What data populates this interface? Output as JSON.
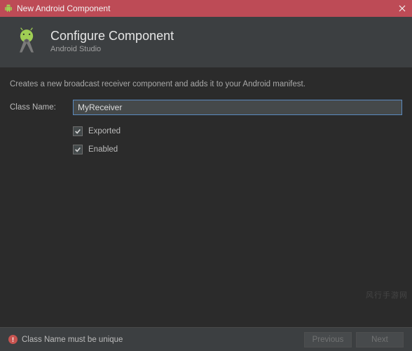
{
  "window": {
    "title": "New Android Component"
  },
  "header": {
    "title": "Configure Component",
    "subtitle": "Android Studio"
  },
  "body": {
    "description": "Creates a new broadcast receiver component and adds it to your Android manifest."
  },
  "form": {
    "class_name": {
      "label": "Class Name:",
      "value": "MyReceiver"
    },
    "exported": {
      "label": "Exported",
      "checked": true
    },
    "enabled": {
      "label": "Enabled",
      "checked": true
    }
  },
  "validation": {
    "message": "Class Name must be unique"
  },
  "footer": {
    "previous": "Previous",
    "next": "Next"
  },
  "watermark": "风行手游网",
  "colors": {
    "titlebar": "#bd4b56",
    "panel": "#3c3f41",
    "body": "#2b2b2b",
    "input_border_focus": "#5b8abf",
    "error": "#c75450"
  }
}
